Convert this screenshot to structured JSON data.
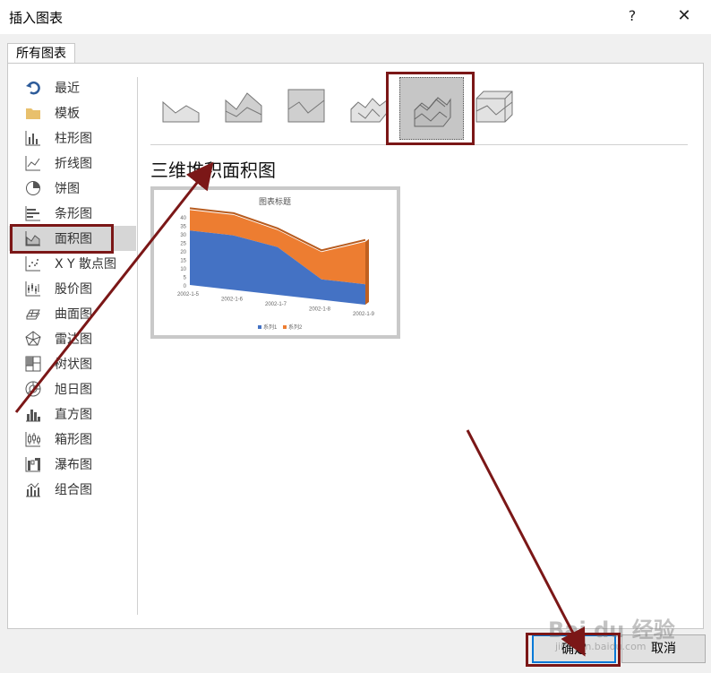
{
  "dialog": {
    "title": "插入图表",
    "help": "?",
    "close": "✕"
  },
  "tab": {
    "label": "所有图表"
  },
  "sidebar": {
    "items": [
      {
        "label": "最近",
        "icon": "recent-icon"
      },
      {
        "label": "模板",
        "icon": "folder-icon"
      },
      {
        "label": "柱形图",
        "icon": "column-chart-icon"
      },
      {
        "label": "折线图",
        "icon": "line-chart-icon"
      },
      {
        "label": "饼图",
        "icon": "pie-chart-icon"
      },
      {
        "label": "条形图",
        "icon": "bar-chart-icon"
      },
      {
        "label": "面积图",
        "icon": "area-chart-icon"
      },
      {
        "label": "X Y 散点图",
        "icon": "scatter-chart-icon"
      },
      {
        "label": "股价图",
        "icon": "stock-chart-icon"
      },
      {
        "label": "曲面图",
        "icon": "surface-chart-icon"
      },
      {
        "label": "雷达图",
        "icon": "radar-chart-icon"
      },
      {
        "label": "树状图",
        "icon": "treemap-chart-icon"
      },
      {
        "label": "旭日图",
        "icon": "sunburst-chart-icon"
      },
      {
        "label": "直方图",
        "icon": "histogram-chart-icon"
      },
      {
        "label": "箱形图",
        "icon": "box-whisker-chart-icon"
      },
      {
        "label": "瀑布图",
        "icon": "waterfall-chart-icon"
      },
      {
        "label": "组合图",
        "icon": "combo-chart-icon"
      }
    ],
    "selected": "面积图"
  },
  "subtypes": {
    "icons": [
      "area-icon",
      "stacked-area-icon",
      "percent-stacked-area-icon",
      "3d-area-icon",
      "3d-stacked-area-icon",
      "3d-percent-stacked-area-icon"
    ],
    "selected_index": 4
  },
  "main": {
    "chart_name": "三维堆积面积图"
  },
  "preview": {
    "title": "图表标题",
    "y_ticks": [
      "40",
      "35",
      "30",
      "25",
      "20",
      "15",
      "10",
      "5",
      "0"
    ],
    "x_ticks": [
      "2002-1-5",
      "2002-1-6",
      "2002-1-7",
      "2002-1-8",
      "2002-1-9"
    ],
    "legend": [
      "系列1",
      "系列2"
    ]
  },
  "chart_data": {
    "type": "area",
    "title": "图表标题",
    "categories": [
      "2002-1-5",
      "2002-1-6",
      "2002-1-7",
      "2002-1-8",
      "2002-1-9"
    ],
    "series": [
      {
        "name": "系列1",
        "values": [
          32,
          32,
          28,
          12,
          12
        ]
      },
      {
        "name": "系列2",
        "values": [
          12,
          12,
          10,
          16,
          25
        ]
      }
    ],
    "ylim": [
      0,
      40
    ],
    "colors": [
      "#4472c4",
      "#ed7d31"
    ],
    "legend": "bottom"
  },
  "buttons": {
    "ok": "确定",
    "cancel": "取消"
  },
  "watermark": {
    "text": "Bai du 经验",
    "url": "jingyan.baidu.com"
  },
  "colors": {
    "highlight": "#7b1717",
    "default_button": "#0078d7"
  }
}
